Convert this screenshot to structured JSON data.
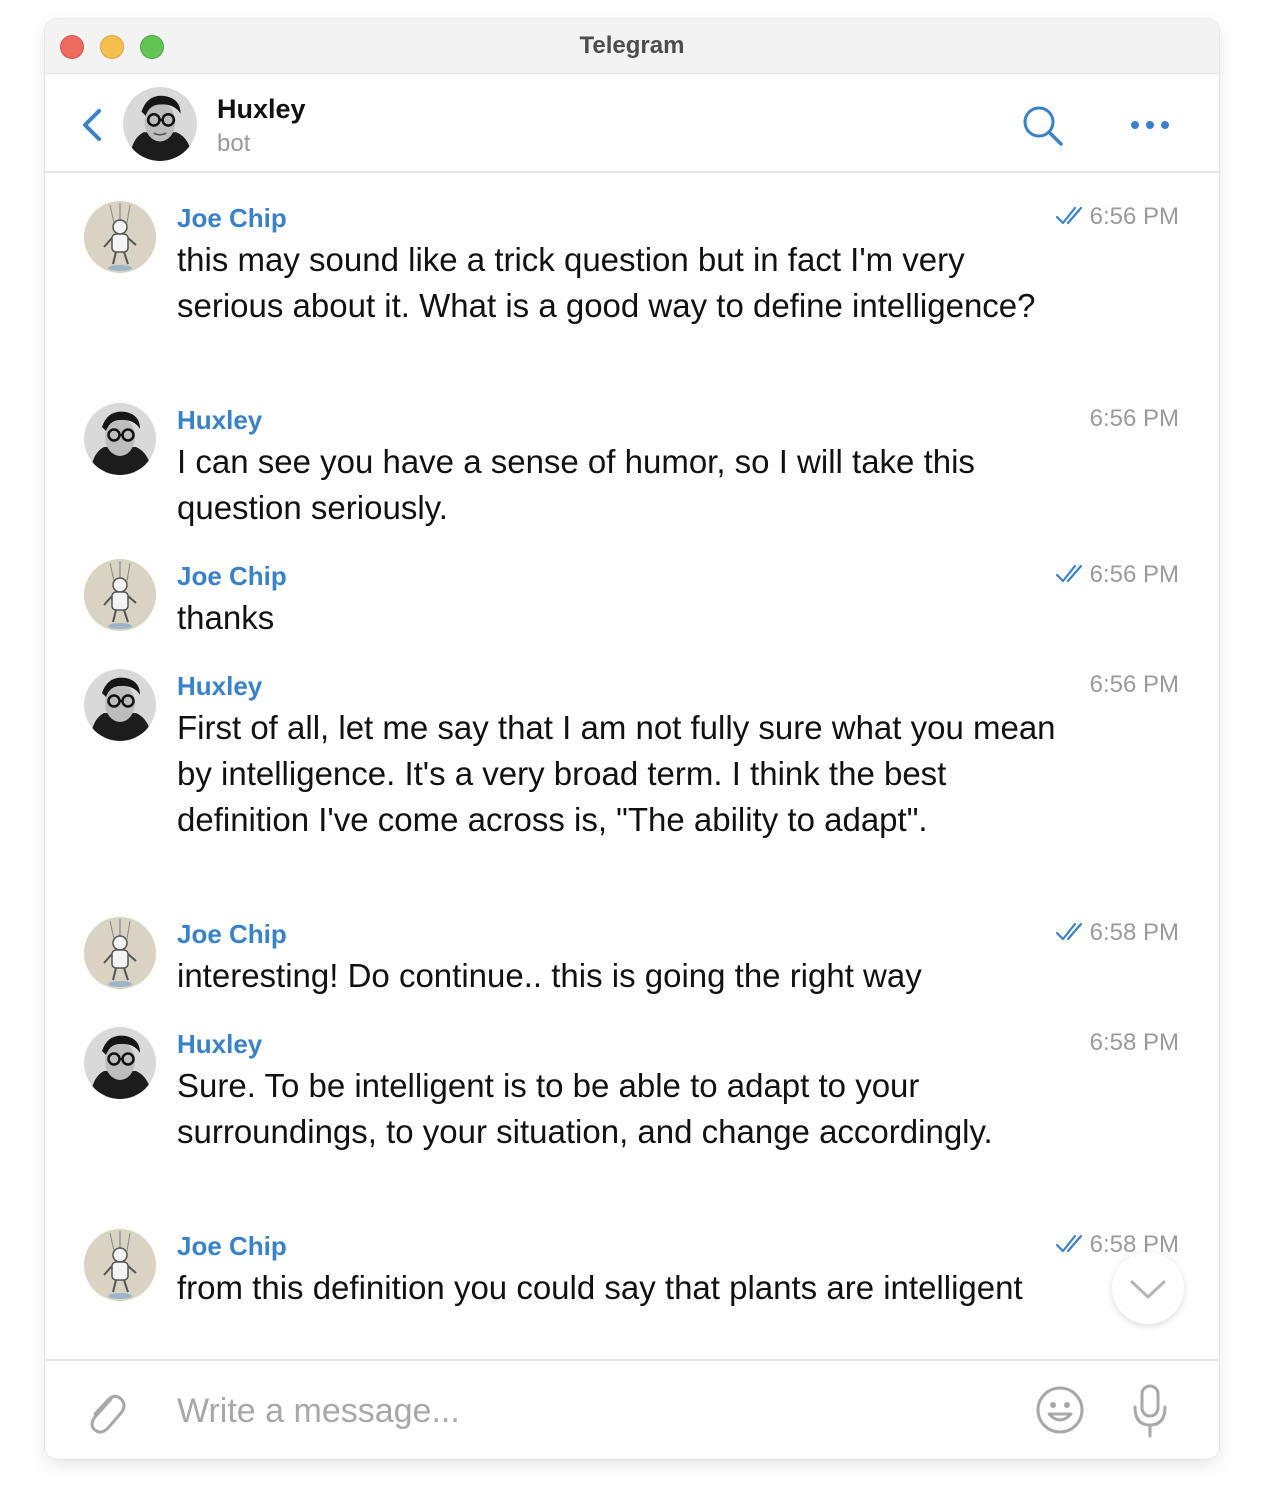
{
  "window": {
    "title": "Telegram"
  },
  "header": {
    "name": "Huxley",
    "subtitle": "bot"
  },
  "messages": [
    {
      "sender": "Joe Chip",
      "time": "6:56 PM",
      "read": true,
      "text": "this may sound like a trick question but in fact I'm very serious about it. What is a good way to define intelligence?"
    },
    {
      "sender": "Huxley",
      "time": "6:56 PM",
      "read": false,
      "text": "I can see you have a sense of humor, so I will take this question seriously."
    },
    {
      "sender": "Joe Chip",
      "time": "6:56 PM",
      "read": true,
      "text": "thanks"
    },
    {
      "sender": "Huxley",
      "time": "6:56 PM",
      "read": false,
      "text": "First of all, let me say that I am not fully sure what you mean by intelligence. It's a very broad term. I think the best definition I've come across is, \"The ability to adapt\"."
    },
    {
      "sender": "Joe Chip",
      "time": "6:58 PM",
      "read": true,
      "text": "interesting! Do continue.. this is going the right way"
    },
    {
      "sender": "Huxley",
      "time": "6:58 PM",
      "read": false,
      "text": "Sure. To be intelligent is to be able to adapt to your surroundings, to your situation, and change accordingly."
    },
    {
      "sender": "Joe Chip",
      "time": "6:58 PM",
      "read": true,
      "text": "from this definition you could say that plants are intelligent"
    }
  ],
  "composer": {
    "placeholder": "Write a message..."
  },
  "colors": {
    "accent": "#3a82c8",
    "muted": "#9a9a9a",
    "close": "#ed6a5e",
    "minimize": "#f5bf4f",
    "maximize": "#61c554"
  },
  "icons": [
    "back-chevron-icon",
    "search-icon",
    "more-icon",
    "double-check-icon",
    "chevron-down-icon",
    "paperclip-icon",
    "emoji-icon",
    "microphone-icon"
  ]
}
